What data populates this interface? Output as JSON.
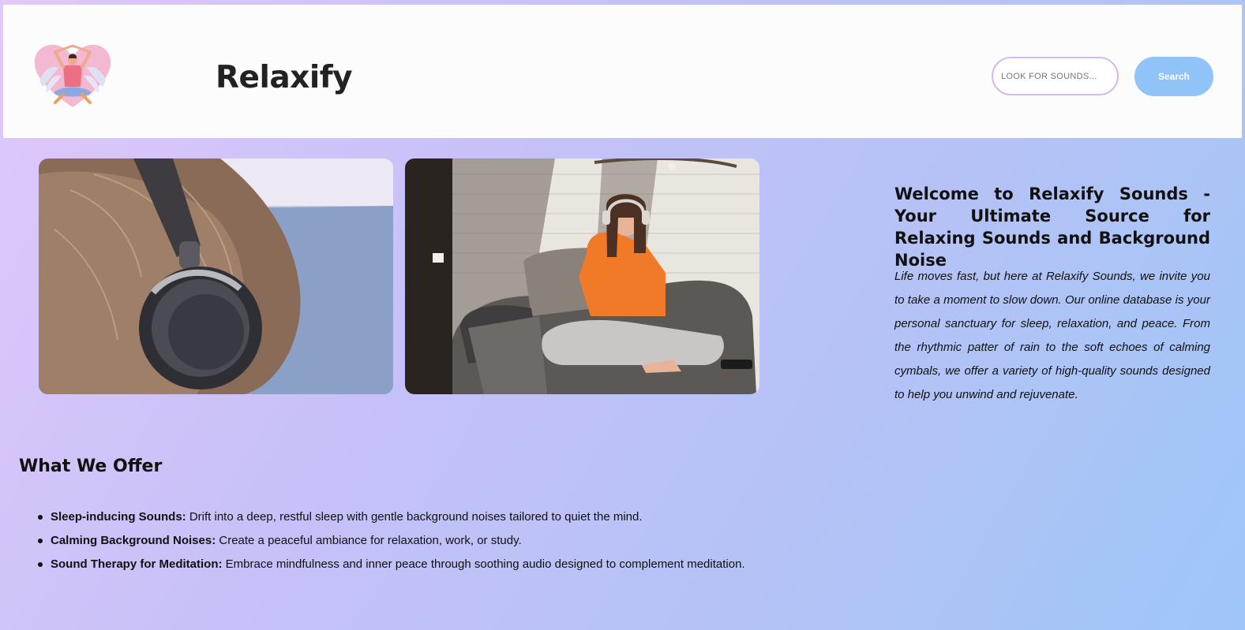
{
  "header": {
    "brand": "Relaxify",
    "logo_icon": "meditation-heart-logo-icon",
    "search": {
      "placeholder": "LOOK FOR SOUNDS...",
      "value": "",
      "button_label": "Search"
    }
  },
  "photos": [
    {
      "name": "headphones-by-the-sea-photo"
    },
    {
      "name": "woman-listening-on-couch-photo"
    }
  ],
  "welcome": {
    "heading": "Welcome to Relaxify Sounds - Your Ultimate Source for Relaxing Sounds and Background Noise",
    "intro": "Life moves fast, but here at Relaxify Sounds, we invite you to take a moment to slow down. Our online database is your personal sanctuary for sleep, relaxation, and peace. From the rhythmic patter of rain to the soft echoes of calming cymbals, we offer a variety of high-quality sounds designed to help you unwind and rejuvenate."
  },
  "offer": {
    "title": "What We Offer",
    "items": [
      {
        "label": "Sleep-inducing Sounds:",
        "text": " Drift into a deep, restful sleep with gentle background noises tailored to quiet the mind."
      },
      {
        "label": "Calming Background Noises:",
        "text": " Create a peaceful ambiance for relaxation, work, or study."
      },
      {
        "label": "Sound Therapy for Meditation:",
        "text": " Embrace mindfulness and inner peace through soothing audio designed to complement meditation."
      }
    ]
  },
  "colors": {
    "search_button": "#90c3f8",
    "search_border": "#d4b8f1",
    "bg_start": "#e0c8fb",
    "bg_end": "#9ec6f7"
  }
}
